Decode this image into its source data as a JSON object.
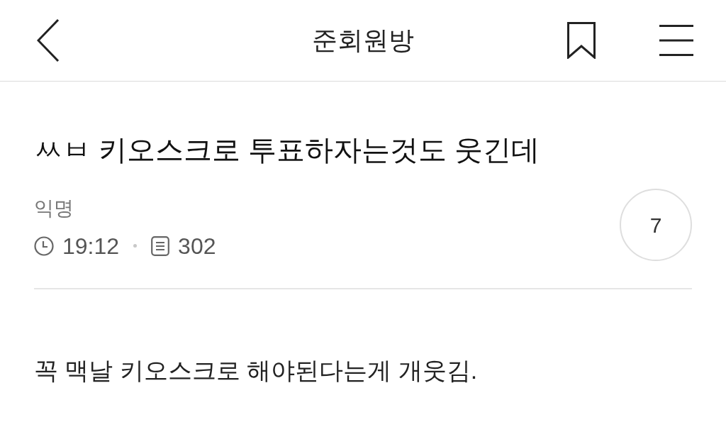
{
  "header": {
    "title": "준회원방"
  },
  "post": {
    "title": "ㅆㅂ 키오스크로 투표하자는것도 웃긴데",
    "author": "익명",
    "time": "19:12",
    "views": "302",
    "comment_count": "7",
    "body": "꼭 맥날 키오스크로 해야된다는게 개웃김."
  }
}
